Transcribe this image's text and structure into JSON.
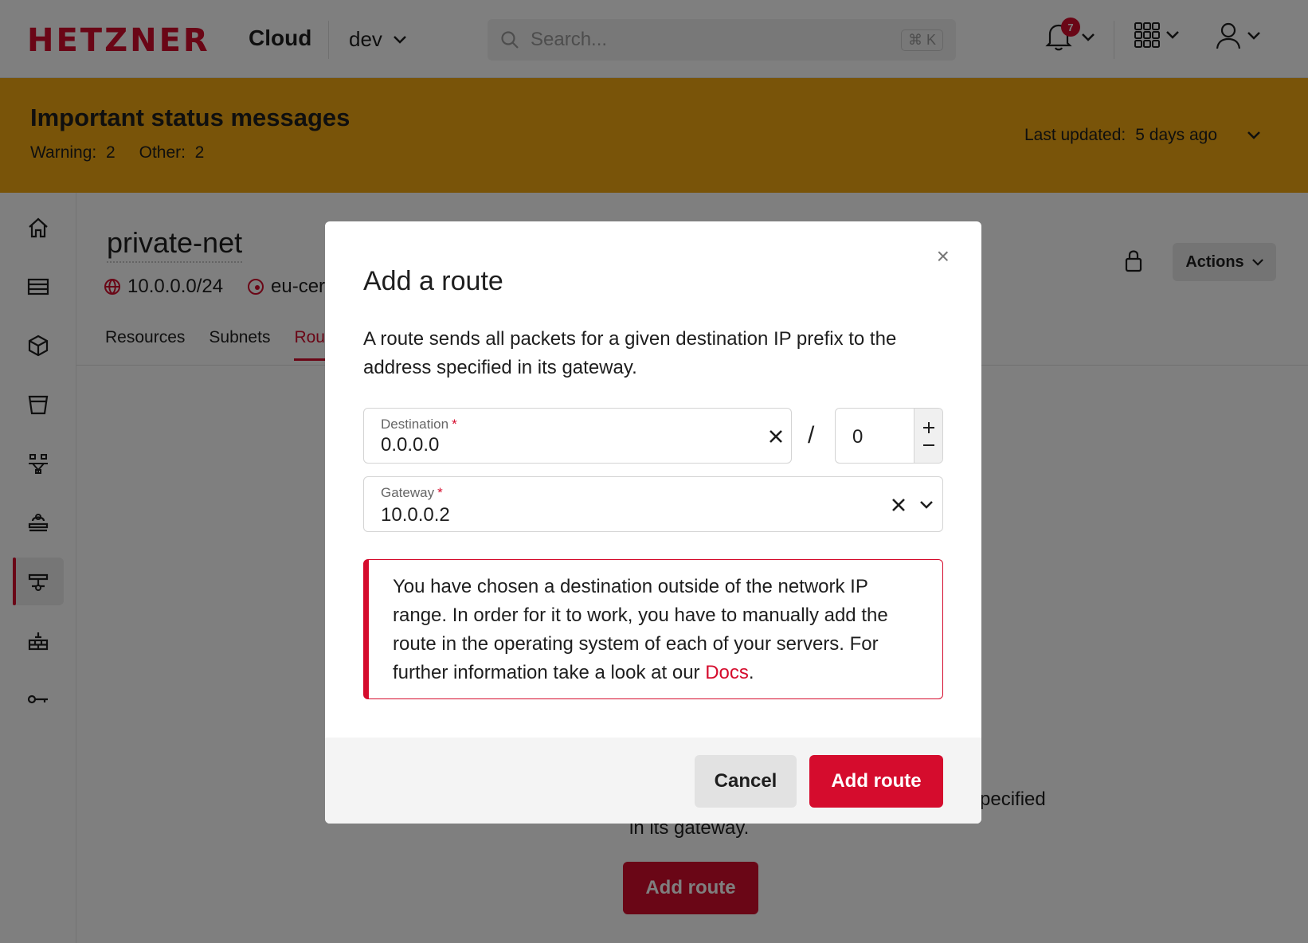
{
  "header": {
    "logo": "HETZNER",
    "product": "Cloud",
    "project": "dev",
    "search_placeholder": "Search...",
    "search_shortcut": "⌘ K",
    "notifications_count": "7"
  },
  "banner": {
    "title": "Important status messages",
    "warning_label": "Warning:",
    "warning_count": "2",
    "other_label": "Other:",
    "other_count": "2",
    "updated_label": "Last updated:",
    "updated_value": "5 days ago"
  },
  "sidebar": {
    "items": [
      {
        "icon": "home-icon"
      },
      {
        "icon": "servers-icon"
      },
      {
        "icon": "volumes-icon"
      },
      {
        "icon": "storage-icon"
      },
      {
        "icon": "load-balancer-icon"
      },
      {
        "icon": "floating-ip-icon"
      },
      {
        "icon": "networks-icon"
      },
      {
        "icon": "firewall-icon"
      },
      {
        "icon": "key-icon"
      }
    ]
  },
  "page": {
    "title": "private-net",
    "ip_range": "10.0.0.0/24",
    "zone": "eu-cer",
    "tabs": [
      "Resources",
      "Subnets",
      "Rou"
    ],
    "actions_label": "Actions",
    "empty_text_1": "pecified",
    "empty_text_2": "in its gateway.",
    "add_route_label": "Add route"
  },
  "modal": {
    "title": "Add a route",
    "description": "A route sends all packets for a given destination IP prefix to the address specified in its gateway.",
    "destination_label": "Destination",
    "destination_value": "0.0.0.0",
    "separator": "/",
    "prefix_value": "0",
    "gateway_label": "Gateway",
    "gateway_value": "10.0.0.2",
    "required_marker": "*",
    "alert_text": "You have chosen a destination outside of the network IP range. In order for it to work, you have to manually add the route in the operating system of each of your servers. For further information take a look at our",
    "alert_link": "Docs",
    "alert_end": ".",
    "cancel_label": "Cancel",
    "submit_label": "Add route",
    "close_glyph": "×"
  },
  "colors": {
    "brand": "#d50c2d",
    "banner": "#f2a912"
  }
}
